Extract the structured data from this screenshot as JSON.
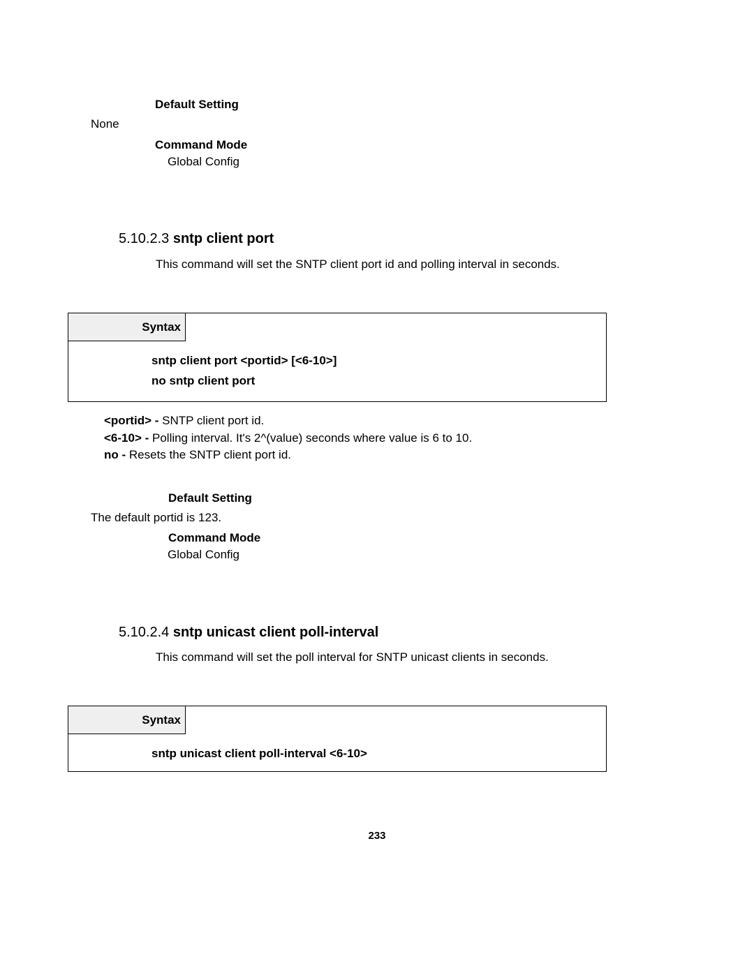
{
  "section0": {
    "defaultSettingLabel": "Default Setting",
    "defaultSettingValue": "None",
    "commandModeLabel": "Command Mode",
    "commandModeValue": "Global Config"
  },
  "section3": {
    "number": "5.10.2.3 ",
    "title": "sntp client port",
    "desc": "This command will set the SNTP client port id and polling interval in seconds.",
    "syntaxLabel": "Syntax",
    "syntaxLine1": "sntp client port <portid> [<6-10>]",
    "syntaxLine2": "no sntp client port",
    "param1_key": "<portid> - ",
    "param1_text": "SNTP client port id.",
    "param2_key": "<6-10> - ",
    "param2_text": "Polling interval. It's 2^(value) seconds where value is 6 to 10.",
    "param3_key": "no - ",
    "param3_text": "Resets the SNTP client port id.",
    "defaultSettingLabel": "Default Setting",
    "defaultSettingValue": "The default portid is 123.",
    "commandModeLabel": "Command Mode",
    "commandModeValue": "Global Config"
  },
  "section4": {
    "number": "5.10.2.4 ",
    "title": "sntp unicast client poll-interval",
    "desc": "This command will set the poll interval for SNTP unicast clients in seconds.",
    "syntaxLabel": "Syntax",
    "syntaxLine1": "sntp unicast client poll-interval <6-10>"
  },
  "pageNumber": "233"
}
